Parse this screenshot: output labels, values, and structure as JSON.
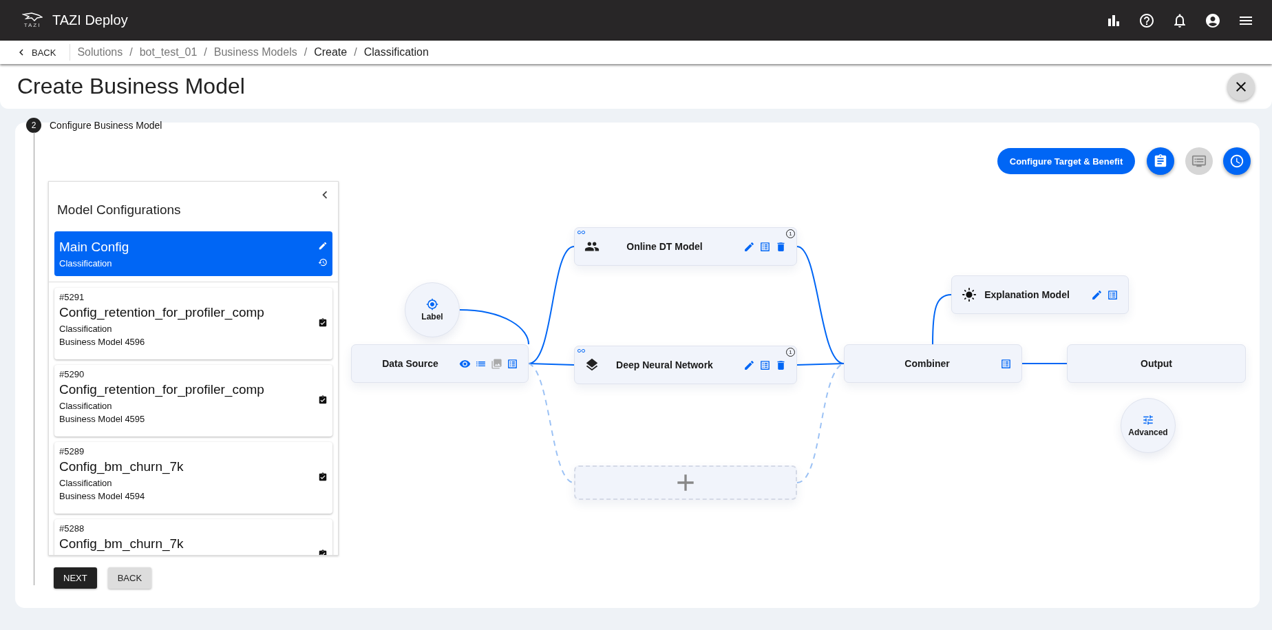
{
  "header": {
    "logo_text": "TAZI",
    "app_title": "TAZI Deploy"
  },
  "breadcrumb": {
    "back": "BACK",
    "items": [
      {
        "label": "Solutions",
        "active": false
      },
      {
        "label": "/",
        "active": false
      },
      {
        "label": "bot_test_01",
        "active": false
      },
      {
        "label": "/",
        "active": false
      },
      {
        "label": "Business Models",
        "active": false
      },
      {
        "label": "/",
        "active": false
      },
      {
        "label": "Create",
        "active": true
      },
      {
        "label": "/",
        "active": false
      },
      {
        "label": "Classification",
        "active": true
      }
    ]
  },
  "page_title": "Create Business Model",
  "step": {
    "number": "2",
    "title": "Configure Business Model"
  },
  "config_panel": {
    "title": "Model Configurations",
    "items": [
      {
        "name": "Main Config",
        "type": "Classification",
        "selected": true
      },
      {
        "id": "#5291",
        "name": "Config_retention_for_profiler_comp",
        "type": "Classification",
        "model": "Business Model 4596",
        "selected": false
      },
      {
        "id": "#5290",
        "name": "Config_retention_for_profiler_comp",
        "type": "Classification",
        "model": "Business Model 4595",
        "selected": false
      },
      {
        "id": "#5289",
        "name": "Config_bm_churn_7k",
        "type": "Classification",
        "model": "Business Model 4594",
        "selected": false
      },
      {
        "id": "#5288",
        "name": "Config_bm_churn_7k",
        "selected": false
      }
    ]
  },
  "actions": {
    "next": "NEXT",
    "back": "BACK"
  },
  "diagram": {
    "primary_button": "Configure Target & Benefit",
    "icon_buttons": [
      {
        "kind": "clipboard",
        "disabled": false
      },
      {
        "kind": "monitor",
        "disabled": true
      },
      {
        "kind": "clock",
        "disabled": false
      }
    ],
    "nodes": [
      {
        "kind": "label",
        "label": "Label"
      },
      {
        "kind": "data_source",
        "label": "Data Source"
      },
      {
        "kind": "model",
        "label": "Online DT Model",
        "badge": "1"
      },
      {
        "kind": "model",
        "label": "Deep Neural Network",
        "badge": "1"
      },
      {
        "kind": "add"
      },
      {
        "kind": "combiner",
        "label": "Combiner"
      },
      {
        "kind": "explanation",
        "label": "Explanation Model"
      },
      {
        "kind": "output",
        "label": "Output"
      },
      {
        "kind": "advanced",
        "label": "Advanced"
      }
    ]
  }
}
